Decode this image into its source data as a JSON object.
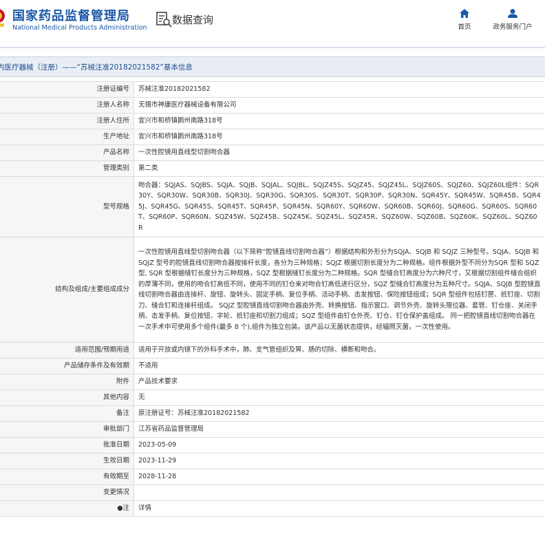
{
  "header": {
    "logo_cn": "国家药品监督管理局",
    "logo_en": "National Medical Products Administration",
    "system_title": "数据查询",
    "nav": [
      {
        "label": "首页",
        "icon": "home-icon"
      },
      {
        "label": "政务服务门户",
        "icon": "user-icon"
      }
    ]
  },
  "title_bar": {
    "text": "内医疗器械（注册）——“苏械注准20182021582”基本信息"
  },
  "rows": [
    {
      "label": "注册证编号",
      "value": "苏械注准20182021582"
    },
    {
      "label": "注册人名称",
      "value": "无锡市神康医疗器械设备有限公司"
    },
    {
      "label": "注册人住所",
      "value": "宜兴市和桥镇鹅州南路318号"
    },
    {
      "label": "生产地址",
      "value": "宜兴市和桥镇鹅州南路318号"
    },
    {
      "label": "产品名称",
      "value": "一次性腔镜用直线型切割吻合器"
    },
    {
      "label": "管理类别",
      "value": "第二类"
    },
    {
      "label": "型号规格",
      "value": "吻合器：SQJAS、SQJBS、SQJA、SQJB、SQJAL、SQJBL、SQJZ45S、SQJZ45、SQJZ45L、SQJZ60S、SQJZ60、SQJZ60L组件：SQR30Y、SQR30W、SQR30B、SQR30J、SQR30G、SQR30S、SQR30T、SQR30P、SQR30N、SQR45Y、SQR45W、SQR45B、SQR45J、SQR45G、SQR45S、SQR45T、SQR45P、SQR45N、SQR60Y、SQR60W、SQR60B、SQR60J、SQR60G、SQR60S、SQR60T、SQR60P、SQR60N、SQZ45W、SQZ45B、SQZ45K、SQZ45L、SQZ45R、SQZ60W、SQZ60B、SQZ60K、SQZ60L、SQZ60R"
    },
    {
      "label": "结构及组成/主要组成成分",
      "value": "一次性腔镜用直线型切割吻合器（以下简称“腔镜直线切割吻合器”）根据结构和外形分为SQJA、SQJB 和 SQJZ 三种型号。SQJA、SQJB 和 SQJZ 型号的腔镜直线切割吻合器按接杆长度，各分为三种规格；SQJZ 根据切割长度分为二种规格。组件根据外型不同分为SQR 型和 SQZ 型, SQR 型根据缝钉长度分为三种规格，SQZ 型根据缝钉长度分为二种规格。SQR 型缝合钉高度分为六种尺寸，又根据切割组件缝合组织的厚薄不同，使用的吻合钉高低不同，使用不同的钉仓来对吻合钉高低进行区分，SQZ 型缝合钉高度分为五种尺寸。SQJA、SQJB 型腔镜直线切割吻合器由连接杆、旋钮、旋转头、固定手柄、复位手柄、活动手柄、击发按钮、保险按钮组成；SQR 型组件包括钉匣、抵钉座、切割刀、缝合钉和连接杆组成。 SQJZ 型腔镜直线切割吻合器由外壳、转换按钮、指示窗口、调节外壳、旋转头限位器、套管、钉仓座、关闭手柄、击发手柄、复位按钮、字轮、抵钉座和切割刀组成；SQZ 型组件由钉仓外壳、钉仓、钉仓保护盖组成。 同一把腔镜直线切割吻合器在一次手术中可使用多个组件(最多 8 个),组件为独立包装。该产品以无菌状态提供，经辐照灭菌，一次性使用。"
    },
    {
      "label": "适用范围/预期用途",
      "value": "适用于开放或内镜下的外科手术中，肺、支气管组织及胃、肠的切除、横断和吻合。"
    },
    {
      "label": "产品储存条件及有效期",
      "value": "不适用"
    },
    {
      "label": "附件",
      "value": "产品技术要求"
    },
    {
      "label": "其他内容",
      "value": "无"
    },
    {
      "label": "备注",
      "value": "原注册证号：苏械注准20182021582"
    },
    {
      "label": "审批部门",
      "value": "江苏省药品监督管理局"
    },
    {
      "label": "批准日期",
      "value": "2023-05-09"
    },
    {
      "label": "生效日期",
      "value": "2023-11-29"
    },
    {
      "label": "有效期至",
      "value": "2028-11-28"
    },
    {
      "label": "变更情况",
      "value": ""
    },
    {
      "label": "●注",
      "value": "详情",
      "link": true
    }
  ],
  "colors": {
    "brand_blue": "#1c58a8",
    "title_bar_bg": "#e9eef5",
    "label_bg": "#f6f6f6",
    "border": "#dcdcdc"
  }
}
